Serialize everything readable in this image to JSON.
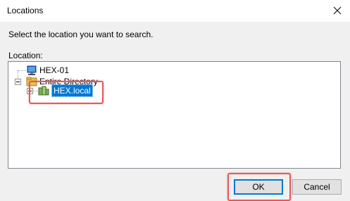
{
  "window": {
    "title": "Locations"
  },
  "instruction": "Select the location you want to search.",
  "location_label": "Location:",
  "tree": {
    "nodes": [
      {
        "label": "HEX-01",
        "icon": "computer-icon"
      },
      {
        "label": "Entire Directory",
        "icon": "directory-icon"
      },
      {
        "label": "HEX.local",
        "icon": "domain-icon",
        "selected": true
      }
    ]
  },
  "buttons": {
    "ok": "OK",
    "cancel": "Cancel"
  },
  "colors": {
    "highlight": "#e8575a",
    "selection": "#0078d7"
  }
}
